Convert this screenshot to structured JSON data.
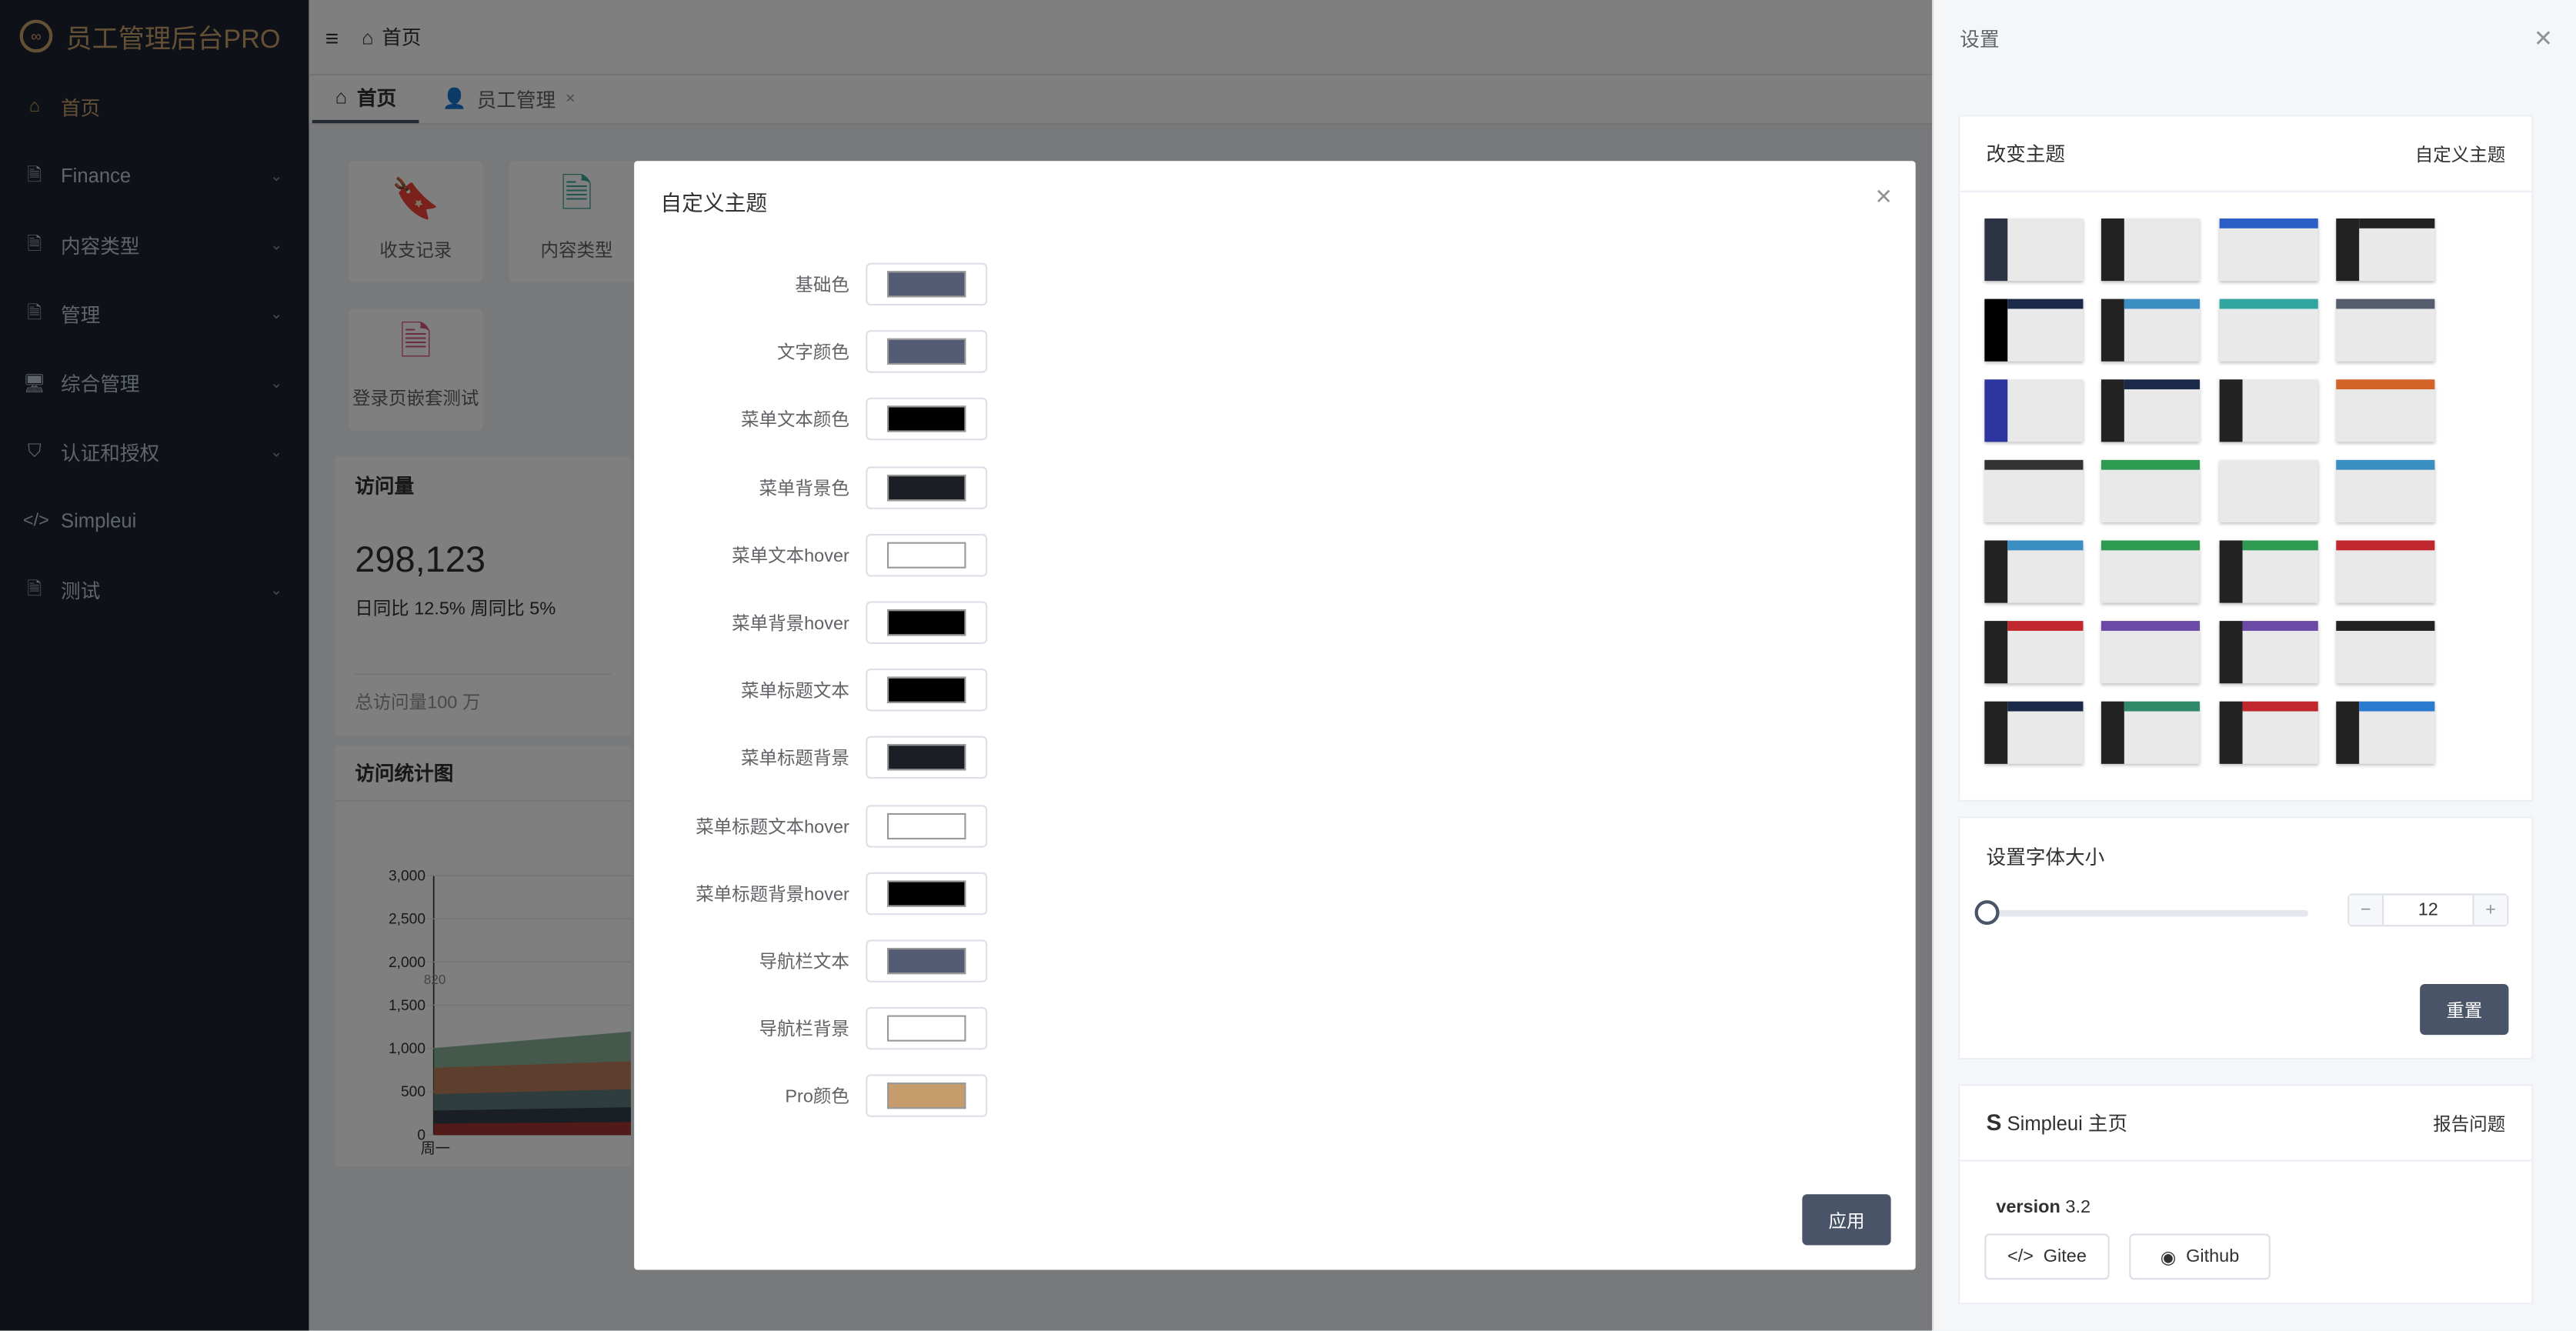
{
  "app": {
    "title": "员工管理后台PRO"
  },
  "sidebar": {
    "items": [
      {
        "label": "首页",
        "icon": "home-icon"
      },
      {
        "label": "Finance",
        "icon": "file-icon"
      },
      {
        "label": "内容类型",
        "icon": "file-icon"
      },
      {
        "label": "管理",
        "icon": "file-icon"
      },
      {
        "label": "综合管理",
        "icon": "desktop-icon"
      },
      {
        "label": "认证和授权",
        "icon": "shield-icon"
      },
      {
        "label": "Simpleui",
        "icon": "code-icon"
      },
      {
        "label": "测试",
        "icon": "file-icon"
      }
    ]
  },
  "navbar": {
    "breadcrumb": "首页"
  },
  "tabs": [
    {
      "label": "首页"
    },
    {
      "label": "员工管理"
    }
  ],
  "tiles": [
    {
      "label": "收支记录"
    },
    {
      "label": "内容类型"
    },
    {
      "label": "登录页嵌套测试"
    }
  ],
  "visits": {
    "title": "访问量",
    "value": "298,123",
    "compare": "日同比 12.5% 周同比 5%",
    "total": "总访问量100 万"
  },
  "stats_chart": {
    "title": "访问统计图"
  },
  "chart_data": {
    "type": "area",
    "title": "访问统计图",
    "categories": [
      "周一"
    ],
    "y_ticks": [
      "3,000",
      "2,500",
      "2,000",
      "1,500",
      "1,000",
      "500",
      "0"
    ],
    "ylim": [
      0,
      3000
    ],
    "data_label": "820"
  },
  "dialog": {
    "title": "自定义主题",
    "apply": "应用",
    "rows": [
      {
        "label": "基础色",
        "color": "#545c75"
      },
      {
        "label": "文字颜色",
        "color": "#545c75"
      },
      {
        "label": "菜单文本颜色",
        "color": "#000000"
      },
      {
        "label": "菜单背景色",
        "color": "#1c1e26"
      },
      {
        "label": "菜单文本hover",
        "color": "#ffffff"
      },
      {
        "label": "菜单背景hover",
        "color": "#000000"
      },
      {
        "label": "菜单标题文本",
        "color": "#000000"
      },
      {
        "label": "菜单标题背景",
        "color": "#1c1e26"
      },
      {
        "label": "菜单标题文本hover",
        "color": "#ffffff"
      },
      {
        "label": "菜单标题背景hover",
        "color": "#000000"
      },
      {
        "label": "导航栏文本",
        "color": "#545c75"
      },
      {
        "label": "导航栏背景",
        "color": "#ffffff"
      },
      {
        "label": "Pro颜色",
        "color": "#c69c6d"
      }
    ]
  },
  "drawer": {
    "title": "设置",
    "theme": {
      "title": "改变主题",
      "custom": "自定义主题"
    },
    "themes": [
      {
        "side": "#2b3345",
        "top": ""
      },
      {
        "side": "#222",
        "top": ""
      },
      {
        "side": "",
        "top": "#2b5fc6"
      },
      {
        "side": "#222",
        "top": "#222"
      },
      {
        "side": "#000",
        "top": "#1c2a4a"
      },
      {
        "side": "#222",
        "top": "#3a8ec2"
      },
      {
        "side": "",
        "top": "#2fa6a0"
      },
      {
        "side": "",
        "top": "#555e6e"
      },
      {
        "side": "#2d35a1",
        "top": ""
      },
      {
        "side": "#222",
        "top": "#1c2a4a"
      },
      {
        "side": "#222",
        "top": ""
      },
      {
        "side": "",
        "top": "#d2642a"
      },
      {
        "side": "",
        "top": "#333"
      },
      {
        "side": "",
        "top": "#2f9a52"
      },
      {
        "side": "",
        "top": ""
      },
      {
        "side": "",
        "top": "#3a8ec2"
      },
      {
        "side": "#222",
        "top": "#3a8ec2"
      },
      {
        "side": "",
        "top": "#2f9a52"
      },
      {
        "side": "#222",
        "top": "#2f9a52"
      },
      {
        "side": "",
        "top": "#c0282e"
      },
      {
        "side": "#222",
        "top": "#c0282e"
      },
      {
        "side": "",
        "top": "#6a4aa6"
      },
      {
        "side": "#222",
        "top": "#6a4aa6"
      },
      {
        "side": "",
        "top": "#222"
      },
      {
        "side": "#222",
        "top": "#1c2a4a"
      },
      {
        "side": "#222",
        "top": "#2f8a6a"
      },
      {
        "side": "#222",
        "top": "#c0282e"
      },
      {
        "side": "#222",
        "top": "#2a7ad0"
      }
    ],
    "font": {
      "title": "设置字体大小",
      "value": "12",
      "minus": "−",
      "plus": "+",
      "reset": "重置",
      "level": 0
    },
    "about": {
      "title": "Simpleui 主页",
      "logo": "S",
      "report": "报告问题",
      "version_label": "version",
      "version": "3.2",
      "gitee": "Gitee",
      "github": "Github"
    }
  }
}
